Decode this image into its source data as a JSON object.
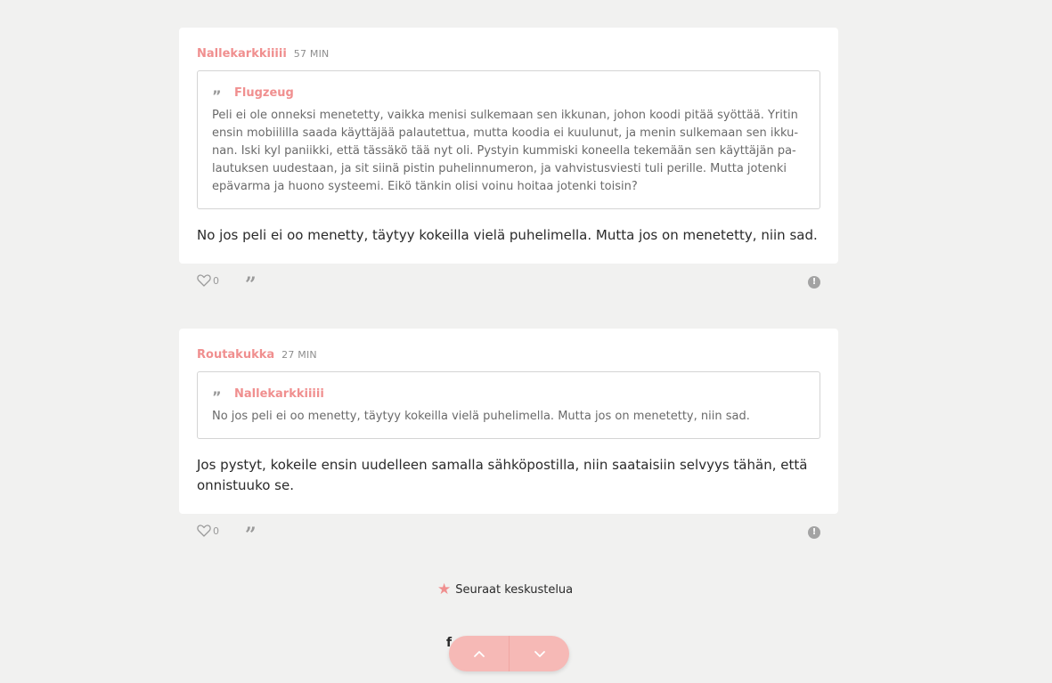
{
  "posts": [
    {
      "author": "Nallekarkkiiiii",
      "time": "57 MIN",
      "quote": {
        "author": "Flugzeug",
        "lines": [
          "Peli ei ole onneksi menetetty, vaikka menisi sulkemaan sen ikkunan, johon koodi pitää syöttää. Yritin",
          "ensin mobiililla saada käyttäjää palautettua, mutta koodia ei kuulunut, ja menin sulkemaan sen ikku-",
          "nan. Iski kyl paniikki, että tässäkö tää nyt oli. Pystyin kummiski koneella tekemään sen käyttäjän pa-",
          "lautuksen uudestaan, ja sit siinä pistin puhelinnumeron, ja vahvistusviesti tuli perille. Mutta jotenki",
          "epävarma ja huono systeemi. Eikö tänkin olisi voinu hoitaa jotenki toisin?"
        ]
      },
      "body": "No jos peli ei oo menetty, täytyy kokeilla vielä puhelimella. Mutta jos on menetetty, niin sad.",
      "likes": "0"
    },
    {
      "author": "Routakukka",
      "time": "27 MIN",
      "quote": {
        "author": "Nallekarkkiiiii",
        "lines": [
          "No jos peli ei oo menetty, täytyy kokeilla vielä puhelimella. Mutta jos on menetetty, niin sad."
        ]
      },
      "body_lines": [
        "Jos pystyt, kokeile ensin uudelleen samalla sähköpostilla, niin saataisiin selvyys tähän, että",
        "onnistuuko se."
      ],
      "likes": "0"
    }
  ],
  "follow_label": "Seuraat keskustelua",
  "fragment": "f",
  "icons": {
    "like": "heart-outline-icon",
    "quote": "quote-icon",
    "report": "report-icon",
    "follow": "star-icon",
    "up": "chevron-up-icon",
    "down": "chevron-down-icon"
  },
  "colors": {
    "accent": "#f08f8f",
    "nav_pill": "#f6b9b6",
    "background": "#f1f1f0"
  }
}
